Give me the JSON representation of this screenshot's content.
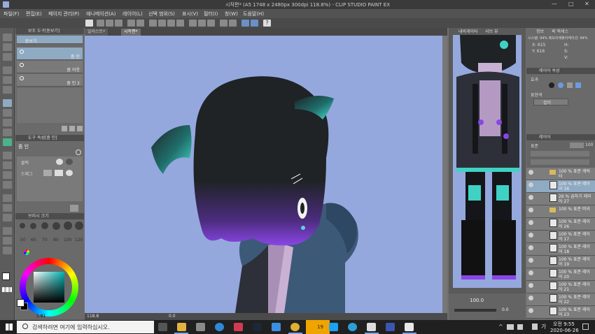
{
  "window": {
    "title": "시작편* (A5 1748 x 2480px 300dpi 118.8%)  - CLIP STUDIO PAINT EX",
    "controls": [
      "—",
      "□",
      "✕"
    ]
  },
  "menu": [
    "파일(F)",
    "편집(E)",
    "페이지 관리(P)",
    "애니메이션(A)",
    "레이어(L)",
    "선택 범위(S)",
    "표시(V)",
    "필터(I)",
    "창(W)",
    "도움말(H)"
  ],
  "subtool_panel": {
    "header": "보조 도구[돋보기]",
    "items": [
      {
        "label": "돋보기",
        "right": ""
      },
      {
        "label": "",
        "right": "줌 인"
      },
      {
        "label": "",
        "right": "줌 아웃"
      },
      {
        "label": "",
        "right": "줌 인 2"
      }
    ]
  },
  "tool_property": {
    "header": "도구 속성[줌 인]",
    "title": "줌 인",
    "rows": [
      {
        "label": "클릭"
      },
      {
        "label": "드래그"
      }
    ]
  },
  "brush_size": {
    "header": "브러시 크기",
    "values": [
      "50",
      "60",
      "70",
      "80",
      "100",
      "120"
    ]
  },
  "color": {
    "main_hex": "#ffffff",
    "sub_hex": "#000000",
    "readout": "1.81"
  },
  "canvas": {
    "tabs": [
      "일러스트*",
      "시작편*"
    ],
    "active_tab": 1,
    "zoom": "118.8",
    "status_extra": "0.0",
    "background": "#94a8dd",
    "character": {
      "hair": "#1f2326",
      "hair_highlight": "#3fd2c4",
      "hair_tip": "#7b3fd6",
      "hood": "#3d5978",
      "shirt": "#c9b1d4",
      "eye_icon_accent": "#5fd0e6"
    }
  },
  "navigator": {
    "tabs": [
      "내비게이터",
      "서브 뷰"
    ],
    "zoom_readout": "100.0",
    "angle_readout": "0.0"
  },
  "info_panel": {
    "tabs": [
      "정보",
      "퀵 액세스"
    ],
    "system": "시스템: 94%  메모리애플리케이션: 94%",
    "x": "X: 615",
    "y": "Y: 616",
    "h": "H:",
    "s": "S:",
    "v": "V:"
  },
  "layer_property": {
    "header": "레이어 속성",
    "effect": "효과",
    "expression": "표현색",
    "mode": "컬러"
  },
  "layer_panel": {
    "header": "레이어",
    "blend": "표준",
    "opacity": "100",
    "layers": [
      {
        "name": "100 % 표준 캐릭터",
        "folder": true,
        "selected": false
      },
      {
        "name": "100 % 표준 레이어 16",
        "folder": false,
        "selected": true
      },
      {
        "name": "26 % 곱하기 레이어 27",
        "folder": false,
        "selected": false
      },
      {
        "name": "100 % 표준 머리",
        "folder": true,
        "selected": false
      },
      {
        "name": "100 % 표준 레이어 26",
        "folder": false,
        "selected": false
      },
      {
        "name": "100 % 표준 레이어 17",
        "folder": false,
        "selected": false
      },
      {
        "name": "100 % 표준 레이어 18",
        "folder": false,
        "selected": false
      },
      {
        "name": "100 % 표준 레이어 19",
        "folder": false,
        "selected": false
      },
      {
        "name": "100 % 표준 레이어 20",
        "folder": false,
        "selected": false
      },
      {
        "name": "100 % 표준 레이어 21",
        "folder": false,
        "selected": false
      },
      {
        "name": "100 % 표준 레이어 22",
        "folder": false,
        "selected": false
      },
      {
        "name": "100 % 표준 레이어 23",
        "folder": false,
        "selected": false
      }
    ]
  },
  "taskbar": {
    "search_placeholder": "검색하려면 여기에 입력하십시오.",
    "badge": "19",
    "time": "오전 9:55",
    "date": "2020-06-26",
    "ime": "가"
  }
}
